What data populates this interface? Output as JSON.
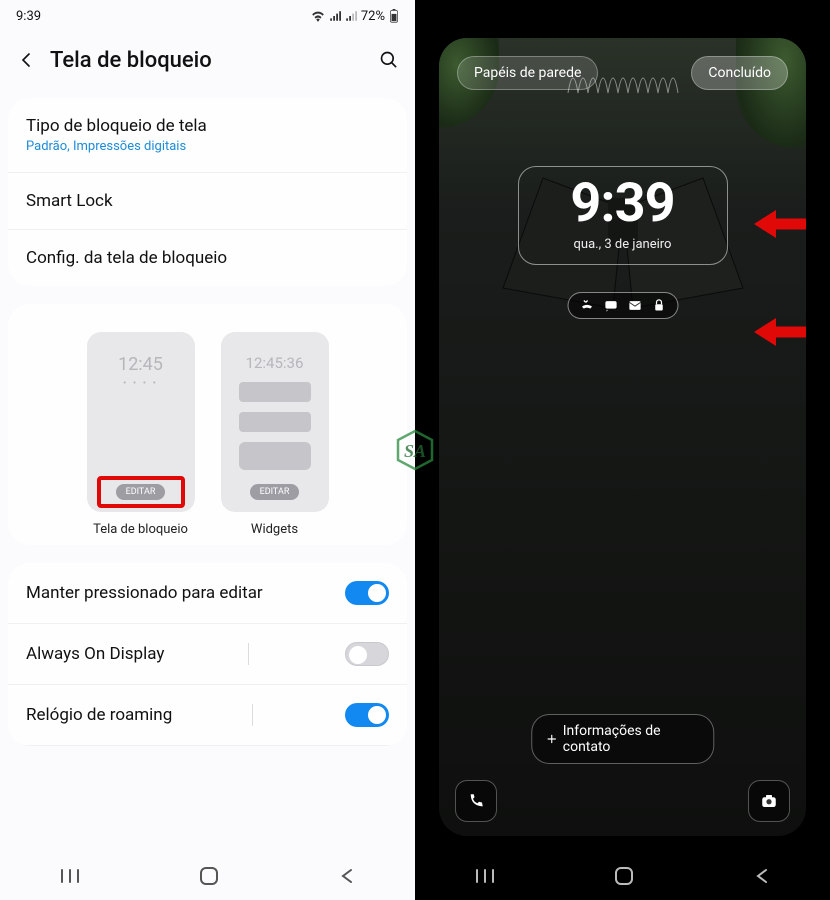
{
  "left": {
    "statusbar": {
      "time": "9:39",
      "battery": "72%"
    },
    "header": {
      "title": "Tela de bloqueio"
    },
    "group1": {
      "row1_title": "Tipo de bloqueio de tela",
      "row1_sub": "Padrão, Impressões digitais",
      "row2": "Smart Lock",
      "row3": "Config. da tela de bloqueio"
    },
    "preview": {
      "lock_clock": "12:45",
      "widget_clock": "12:45:36",
      "editar": "EDITAR",
      "label_lock": "Tela de bloqueio",
      "label_widgets": "Widgets"
    },
    "toggles": {
      "t1_label": "Manter pressionado para editar",
      "t1_on": true,
      "t2_label": "Always On Display",
      "t2_on": false,
      "t3_label": "Relógio de roaming",
      "t3_on": true
    }
  },
  "right": {
    "wallpapers": "Papéis de parede",
    "done": "Concluído",
    "time": "9:39",
    "date": "qua., 3 de janeiro",
    "contact": "Informações de contato"
  }
}
